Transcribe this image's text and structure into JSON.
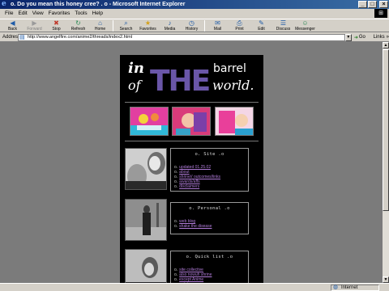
{
  "window": {
    "title": "o. Do you mean this honey cree? . o - Microsoft Internet Explorer",
    "controls": {
      "minimize": "_",
      "maximize": "□",
      "close": "×"
    }
  },
  "menu": [
    "File",
    "Edit",
    "View",
    "Favorites",
    "Tools",
    "Help"
  ],
  "toolbar": [
    {
      "label": "Back",
      "icon": "arrow-left",
      "disabled": false
    },
    {
      "label": "Forward",
      "icon": "arrow-right",
      "disabled": true
    },
    {
      "label": "Stop",
      "icon": "stop",
      "disabled": false
    },
    {
      "label": "Refresh",
      "icon": "refresh",
      "disabled": false
    },
    {
      "label": "Home",
      "icon": "home",
      "disabled": false
    },
    {
      "label": "Search",
      "icon": "search",
      "disabled": false
    },
    {
      "label": "Favorites",
      "icon": "favorites",
      "disabled": false
    },
    {
      "label": "Media",
      "icon": "media",
      "disabled": false
    },
    {
      "label": "History",
      "icon": "history",
      "disabled": false
    },
    {
      "label": "Mail",
      "icon": "mail",
      "disabled": false
    },
    {
      "label": "Print",
      "icon": "print",
      "disabled": false
    },
    {
      "label": "Edit",
      "icon": "edit",
      "disabled": false
    },
    {
      "label": "Discuss",
      "icon": "discuss",
      "disabled": false
    },
    {
      "label": "Messenger",
      "icon": "messenger",
      "disabled": false
    }
  ],
  "address": {
    "label": "Address",
    "url": "http://www.angelfire.com/anime2/threads/index2.html",
    "go_label": "Go",
    "links_label": "Links"
  },
  "status": {
    "text": "",
    "zone": "Internet"
  },
  "site": {
    "logo": {
      "in": "in",
      "the": "THE",
      "barrel": "barrel",
      "of": "of",
      "world": "world."
    },
    "cards": [
      {
        "title": "o. Site .o",
        "items": [
          {
            "bullet": "o.",
            "text": "updated 01.25.02"
          },
          {
            "bullet": "o.",
            "text": "about"
          },
          {
            "bullet": "o.",
            "text": "shrine// outcomes/links"
          },
          {
            "bullet": "o.",
            "text": "awards/affs"
          },
          {
            "bullet": "o.",
            "text": "disclaimers"
          }
        ]
      },
      {
        "title": "o. Personal .o",
        "items": [
          {
            "bullet": "o.",
            "text": "web blog"
          },
          {
            "bullet": "o.",
            "text": "shake the disease"
          }
        ]
      },
      {
        "title": "o. Quick list .o",
        "items": [
          {
            "bullet": "o.",
            "text": "site collective"
          },
          {
            "bullet": "o.",
            "text": "also nowuh shrine"
          },
          {
            "bullet": "o.",
            "text": "except Anime"
          },
          {
            "bullet": "o.",
            "text": "sotet"
          }
        ]
      }
    ]
  },
  "colors": {
    "titlebar": "#0a246a",
    "chrome": "#d4d0c8",
    "desktop": "#7b7b7b",
    "site_bg": "#000000",
    "link": "#b07bd8",
    "logo_the": "#6a56a8"
  }
}
